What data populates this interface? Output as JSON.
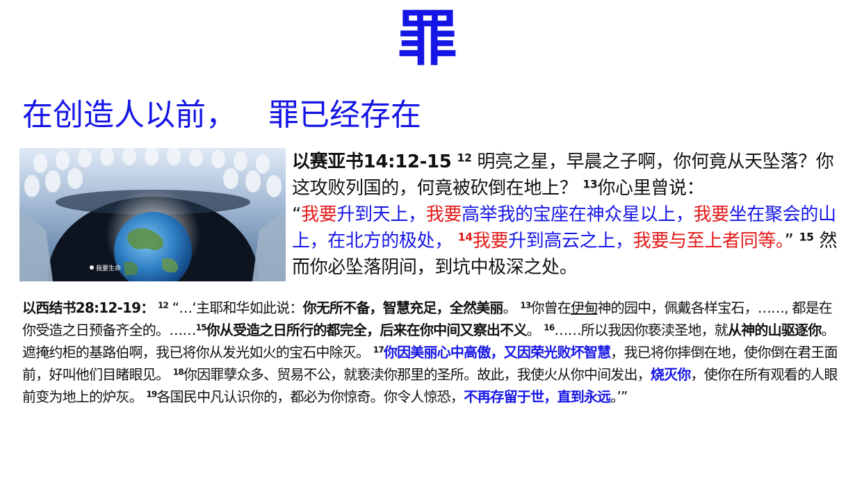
{
  "title": "罪",
  "subtitle": {
    "part1": "在创造人以前，",
    "part2": "罪已经存在"
  },
  "image": {
    "watermark": "我要生命"
  },
  "isaiah": {
    "ref": "以赛亚书14:12-15",
    "v12": "12",
    "t12": "明亮之星，早晨之子啊，你何竟从天坠落？你这攻败列国的，何竟被砍倒在地上？",
    "v13": "13",
    "t13": "你心里曾说：",
    "q_open": "“",
    "s1": "我要",
    "s2": "升到天上，",
    "s3": "我要",
    "s4": "高举我的宝座在神众星以上，",
    "s5": "我要",
    "s6": "坐在聚会的山上，在北方的极处，",
    "v14": "14",
    "s7": "我要",
    "s8": "升到高云之上，",
    "s9": "我要",
    "s10": "与至上者同等。",
    "q_close": "”",
    "v15": "15",
    "t15": "然而你必坠落阴间，到坑中极深之处。"
  },
  "ezekiel": {
    "ref": "以西结书28:12-19：",
    "v12": "12",
    "t12a": "“…‘主耶和华如此说：",
    "t12b": "你无所不备，智慧充足，全然美丽",
    "t12c": "。",
    "v13": "13",
    "t13a": "你曾在",
    "t13b": "伊甸",
    "t13c": "神的园中，佩戴各样宝石，……, 都是在你受造之日预备齐全的。……",
    "v15": "15",
    "t15": "你从受造之日所行的都完全，后来在你中间又察出不义",
    "t15c": "。",
    "v16": "16",
    "t16a": "……所以我因你亵渎圣地，就",
    "t16b": "从神的山驱逐你",
    "t16c": "。遮掩约柜的基路伯啊，我已将你从发光如火的宝石中除灭。",
    "v17": "17",
    "t17a": "你因美丽心中高傲，又因荣光败坏智慧",
    "t17b": "，我已将你摔倒在地，使你倒在君王面前，好叫他们目睹眼见。",
    "v18": "18",
    "t18a": "你因罪孽众多、贸易不公，就亵渎你那里的圣所。故此，我使火从你中间发出，",
    "t18b": "烧灭你",
    "t18c": "，使你在所有观看的人眼前变为地上的炉灰。",
    "v19": "19",
    "t19a": "各国民中凡认识你的，都必为你惊奇。你令人惊恐，",
    "t19b": "不再存留于世，直到永远",
    "t19c": "。’”"
  },
  "colors": {
    "accent_blue": "#1515e6",
    "accent_red": "#e31919",
    "text": "#111111"
  }
}
